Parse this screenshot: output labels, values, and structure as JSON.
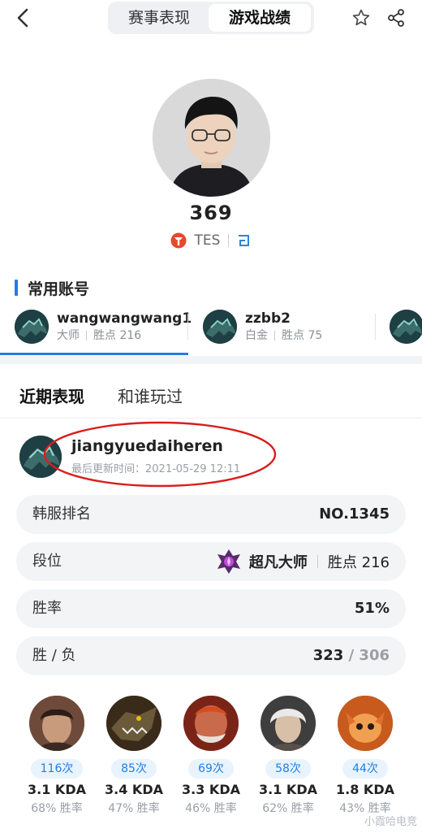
{
  "header": {
    "tabs": [
      "赛事表现",
      "游戏战绩"
    ],
    "active_tab": "游戏战绩"
  },
  "profile": {
    "nickname": "369",
    "team": "TES"
  },
  "accounts": {
    "title": "常用账号",
    "items": [
      {
        "name": "wangwangwang1",
        "rank": "大师",
        "points": "胜点 216"
      },
      {
        "name": "zzbb2",
        "rank": "白金",
        "points": "胜点 75"
      }
    ]
  },
  "recent": {
    "tabs": [
      "近期表现",
      "和谁玩过"
    ],
    "account_name": "jiangyuedaiheren",
    "updated": "最后更新时间：2021-05-29 12:11"
  },
  "stats": {
    "kr_rank_label": "韩服排名",
    "kr_rank_value": "NO.1345",
    "tier_label": "段位",
    "tier_value": "超凡大师",
    "tier_points": "胜点 216",
    "winrate_label": "胜率",
    "winrate_value": "51%",
    "wl_label": "胜 / 负",
    "wins": "323",
    "wl_sep": " / ",
    "losses": "306"
  },
  "champions": [
    {
      "count": "116次",
      "kda": "3.1 KDA",
      "winrate": "68% 胜率"
    },
    {
      "count": "85次",
      "kda": "3.4 KDA",
      "winrate": "47% 胜率"
    },
    {
      "count": "69次",
      "kda": "3.3 KDA",
      "winrate": "46% 胜率"
    },
    {
      "count": "58次",
      "kda": "3.1 KDA",
      "winrate": "62% 胜率"
    },
    {
      "count": "44次",
      "kda": "1.8 KDA",
      "winrate": "43% 胜率"
    }
  ],
  "watermark": "小霞哈电竞",
  "colors": {
    "accent": "#1e7fe6",
    "team_red": "#e24a2e",
    "ellipse": "#d91e1e"
  }
}
